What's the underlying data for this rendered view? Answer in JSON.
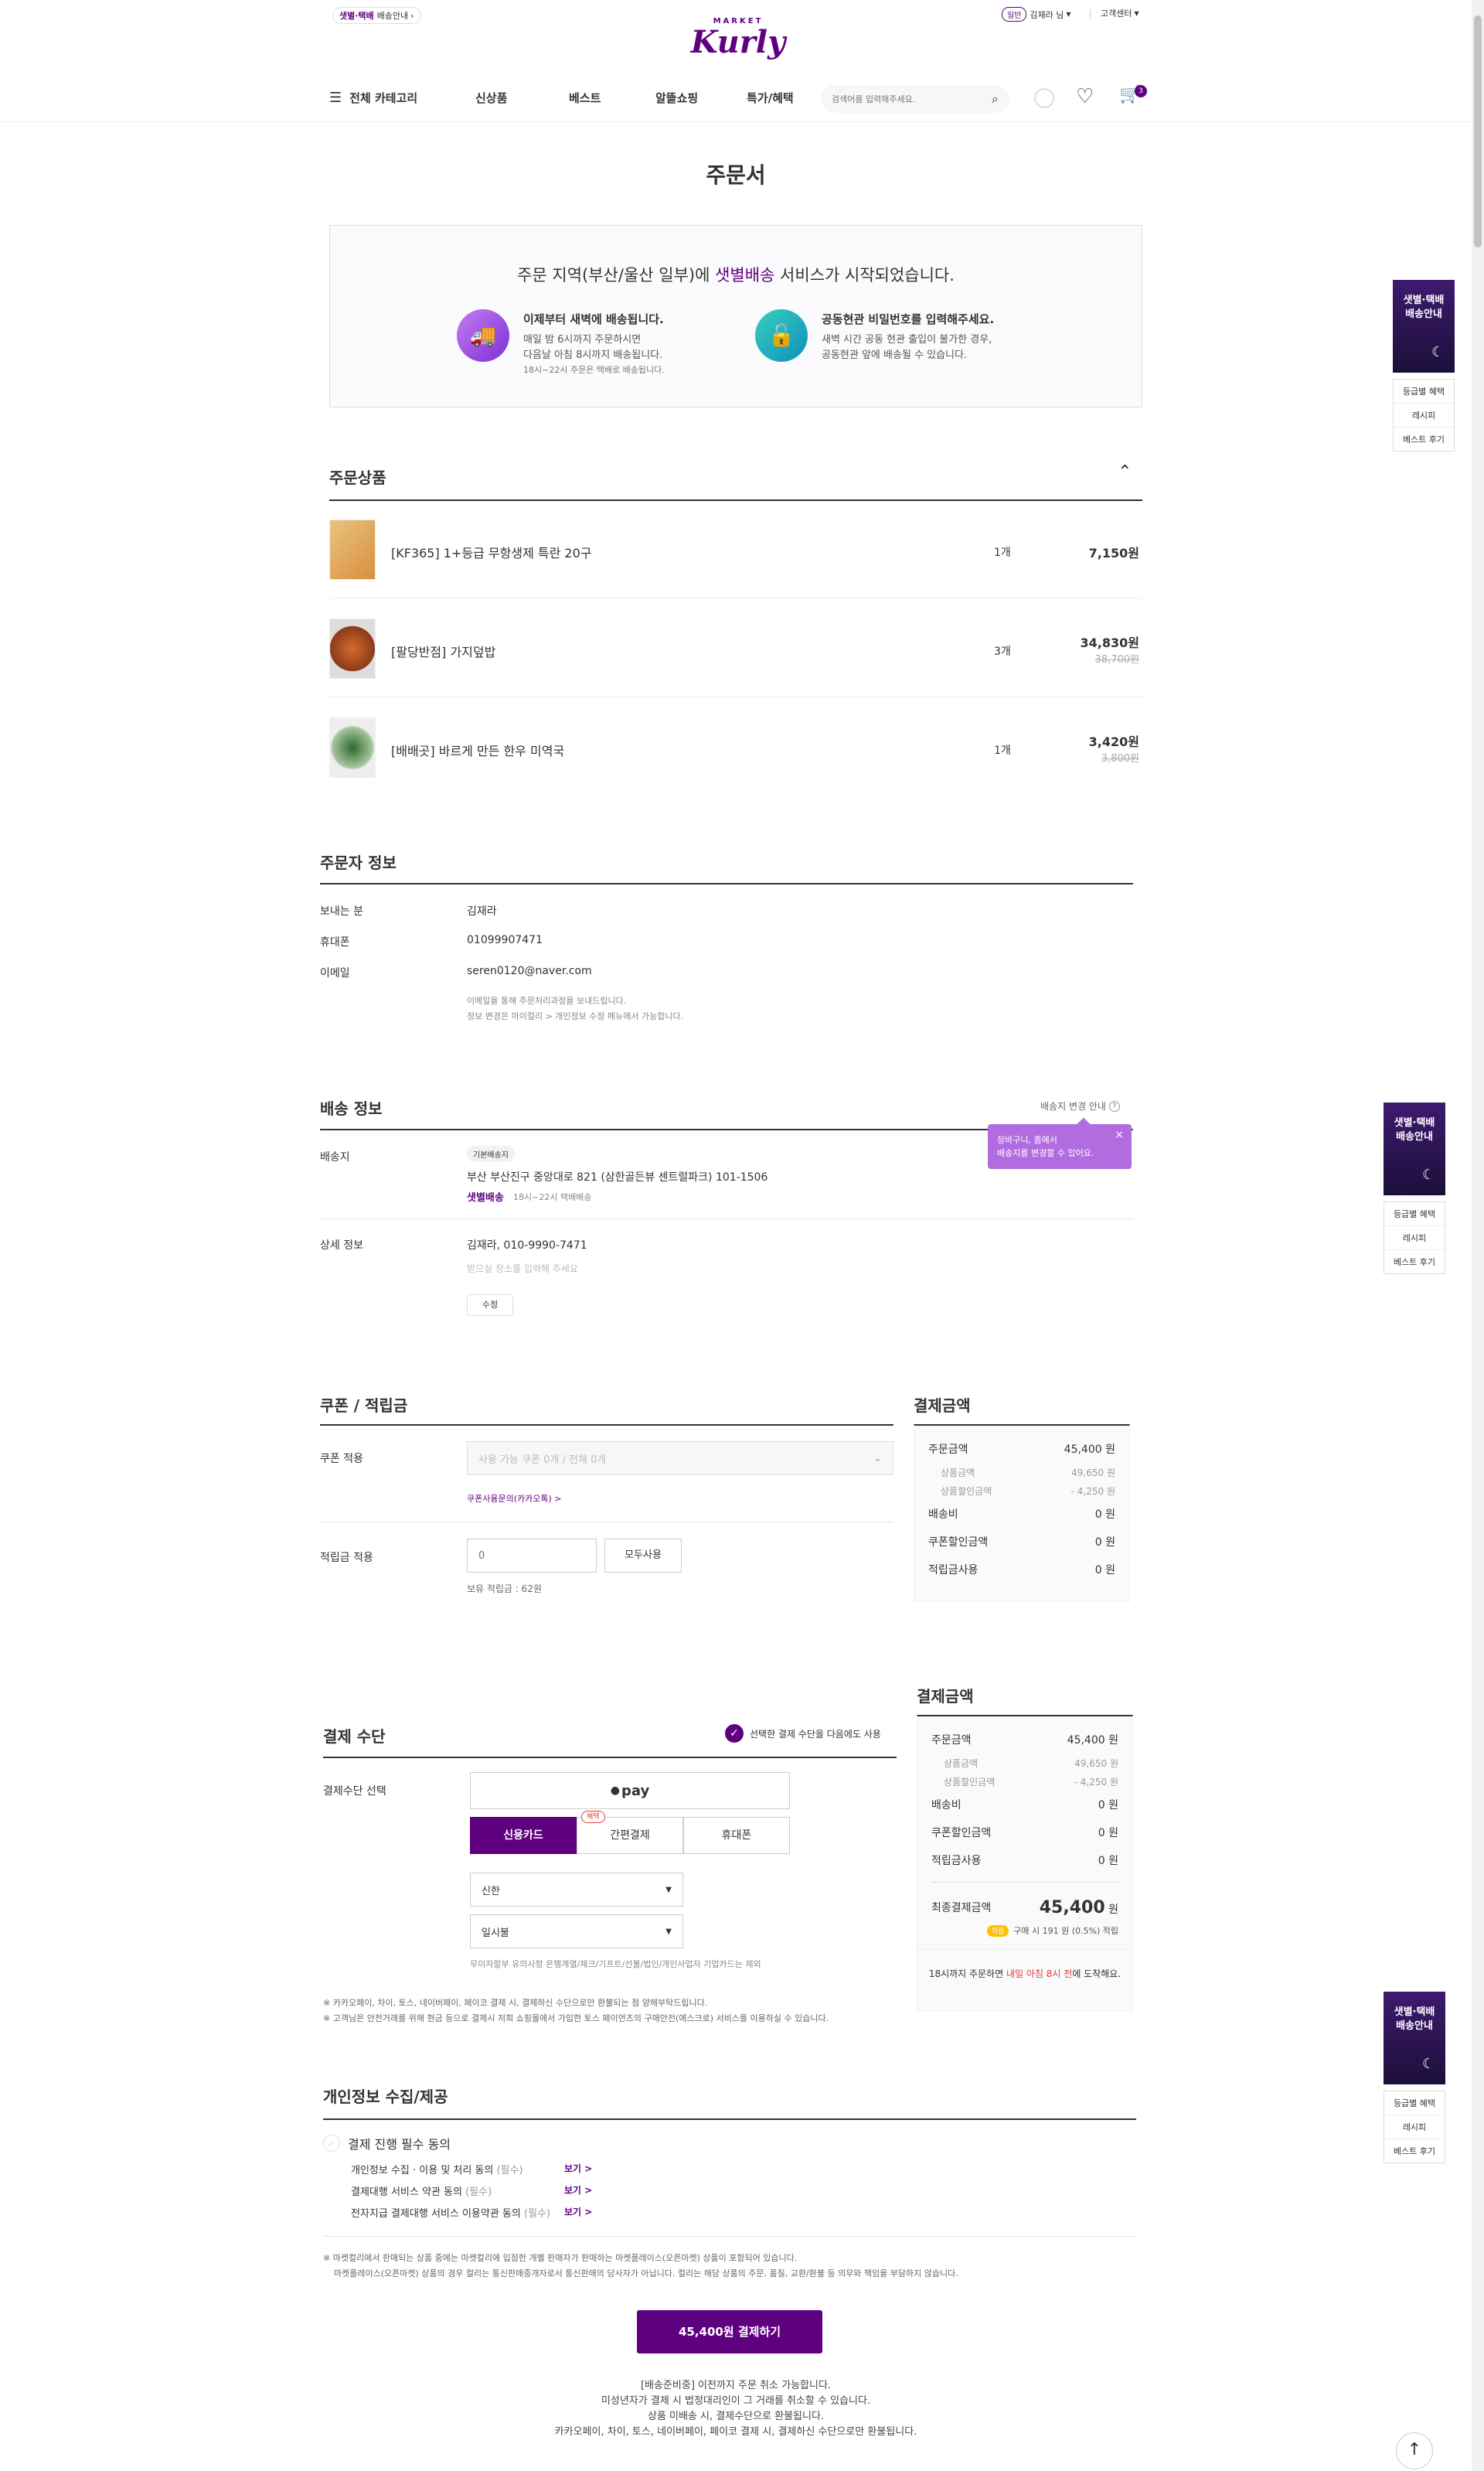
{
  "header": {
    "delivery_badge": "샛별·택배",
    "delivery_info": "배송안내",
    "logo_market": "MARKET",
    "logo_text": "Kurly",
    "grade_badge": "일반",
    "user_name": "김재라 님",
    "customer_center": "고객센터",
    "nav": {
      "all_categories": "전체 카테고리",
      "new": "신상품",
      "best": "베스트",
      "deal": "알뜰쇼핑",
      "special": "특가/혜택"
    },
    "search_placeholder": "검색어를 입력해주세요.",
    "cart_count": "3"
  },
  "page_title": "주문서",
  "notice": {
    "title_pre": "주문 지역(부산/울산 일부)에 ",
    "title_highlight": "샛별배송",
    "title_post": " 서비스가 시작되었습니다.",
    "item1_title": "이제부터 새벽에 배송됩니다.",
    "item1_line1": "매일 밤 6시까지 주문하시면",
    "item1_line2": "다음날 아침 8시까지 배송됩니다.",
    "item1_line3": "18시~22시 주문은 택배로 배송됩니다.",
    "item2_title": "공동현관 비밀번호를 입력해주세요.",
    "item2_line1": "새벽 시간 공동 현관 출입이 불가한 경우,",
    "item2_line2": "공동현관 앞에 배송될 수 있습니다."
  },
  "order_items": {
    "section_title": "주문상품",
    "items": [
      {
        "name": "[KF365] 1+등급 무항생제 특란 20구",
        "qty": "1개",
        "price": "7,150원",
        "original": ""
      },
      {
        "name": "[팔당반점] 가지덮밥",
        "qty": "3개",
        "price": "34,830원",
        "original": "38,700원"
      },
      {
        "name": "[배배곳] 바르게 만든 한우 미역국",
        "qty": "1개",
        "price": "3,420원",
        "original": "3,800원"
      }
    ]
  },
  "orderer": {
    "section_title": "주문자 정보",
    "sender_label": "보내는 분",
    "sender_value": "김재라",
    "phone_label": "휴대폰",
    "phone_value": "01099907471",
    "email_label": "이메일",
    "email_value": "seren0120@naver.com",
    "email_note1": "이메일을 통해 주문처리과정을 보내드립니다.",
    "email_note2": "정보 변경은 마이컬리 > 개인정보 수정 메뉴에서 가능합니다."
  },
  "shipping": {
    "section_title": "배송 정보",
    "change_guide": "배송지 변경 안내",
    "tooltip_line1": "장바구니, 홈에서",
    "tooltip_line2": "배송지를 변경할 수 있어요.",
    "address_label": "배송지",
    "default_badge": "기본배송지",
    "address": "부산 부산진구 중앙대로 821 (삼한골든뷰 센트럴파크) 101-1506",
    "delivery_type": "샛별배송",
    "delivery_note": "18시~22시 택배배송",
    "detail_label": "상세 정보",
    "receiver": "김재라, 010-9990-7471",
    "place_placeholder": "받으실 장소를 입력해 주세요",
    "edit_button": "수정"
  },
  "coupon": {
    "section_title": "쿠폰 / 적립금",
    "coupon_label": "쿠폰 적용",
    "coupon_select": "사용 가능 쿠폰 0개 / 전체 0개",
    "coupon_inquiry": "쿠폰사용문의(카카오톡) >",
    "points_label": "적립금 적용",
    "points_placeholder": "0",
    "use_all_button": "모두사용",
    "points_balance": "보유 적립금 : 62원"
  },
  "summary_top": {
    "title": "결제금액",
    "order_amount_label": "주문금액",
    "order_amount": "45,400 원",
    "product_amount_label": "상품금액",
    "product_amount": "49,650 원",
    "product_discount_label": "상품할인금액",
    "product_discount": "- 4,250 원",
    "shipping_label": "배송비",
    "shipping": "0 원",
    "coupon_label": "쿠폰할인금액",
    "coupon": "0 원",
    "points_label": "적립금사용",
    "points": "0 원"
  },
  "summary_bottom": {
    "title": "결제금액",
    "final_label": "최종결제금액",
    "final_value": "45,400",
    "final_unit": "원",
    "reward_badge": "적립",
    "reward_text": "구매 시 191 원 (0.5%) 적립",
    "delivery_note_pre": "18시까지 주문하면 ",
    "delivery_note_highlight": "내일 아침 8시 전",
    "delivery_note_post": "에 도착해요."
  },
  "payment": {
    "section_title": "결제 수단",
    "remember_label": "선택한 결제 수단을 다음에도 사용",
    "method_label": "결제수단 선택",
    "kakaopay": "pay",
    "card_button": "신용카드",
    "easy_button": "간편결제",
    "easy_badge": "혜택",
    "phone_button": "휴대폰",
    "card_company": "신한",
    "installment": "일시불",
    "installment_note": "무이자할부 유의사항 은행계열/체크/기프트/선불/법인/개인사업자 기업카드는 제외",
    "note1": "※ 카카오페이, 차이, 토스, 네이버페이, 페이코 결제 시, 결제하신 수단으로만 환불되는 점 양해부탁드립니다.",
    "note2": "※ 고객님은 안전거래를 위해 현금 등으로 결제시 저희 쇼핑몰에서 가입한 토스 페이먼츠의 구매안전(에스크로) 서비스를 이용하실 수 있습니다."
  },
  "privacy": {
    "section_title": "개인정보 수집/제공",
    "agree_all": "결제 진행 필수 동의",
    "items": [
      {
        "label": "개인정보 수집 · 이용 및 처리 동의",
        "req": "(필수)",
        "link": "보기 >"
      },
      {
        "label": "결제대행 서비스 약관 동의",
        "req": "(필수)",
        "link": "보기 >"
      },
      {
        "label": "전자지급 결제대행 서비스 이용약관 동의",
        "req": "(필수)",
        "link": "보기 >"
      }
    ],
    "notice1": "※ 마켓컬리에서 판매되는 상품 중에는 마켓컬리에 입점한 개별 판매자가 판매하는 마켓플레이스(오픈마켓) 상품이 포함되어 있습니다.",
    "notice2": "마켓플레이스(오픈마켓) 상품의 경우 컬리는 통신판매중개자로서 통신판매의 당사자가 아닙니다. 컬리는 해당 상품의 주문, 품질, 교환/환불 등 의무와 책임을 부담하지 않습니다."
  },
  "pay_button": "45,400원 결제하기",
  "footer": {
    "line1": "[배송준비중] 이전까지 주문 취소 가능합니다.",
    "line2": "미성년자가 결제 시 법정대리인이 그 거래를 취소할 수 있습니다.",
    "line3": "상품 미배송 시, 결제수단으로 환불됩니다.",
    "line4": "카카오페이, 차이, 토스, 네이버페이, 페이코 결제 시, 결제하신 수단으로만 환불됩니다."
  },
  "sidebar": {
    "banner_line1": "샛별·택배",
    "banner_line2": "배송안내",
    "link1": "등급별 혜택",
    "link2": "레시피",
    "link3": "베스트 후기"
  }
}
